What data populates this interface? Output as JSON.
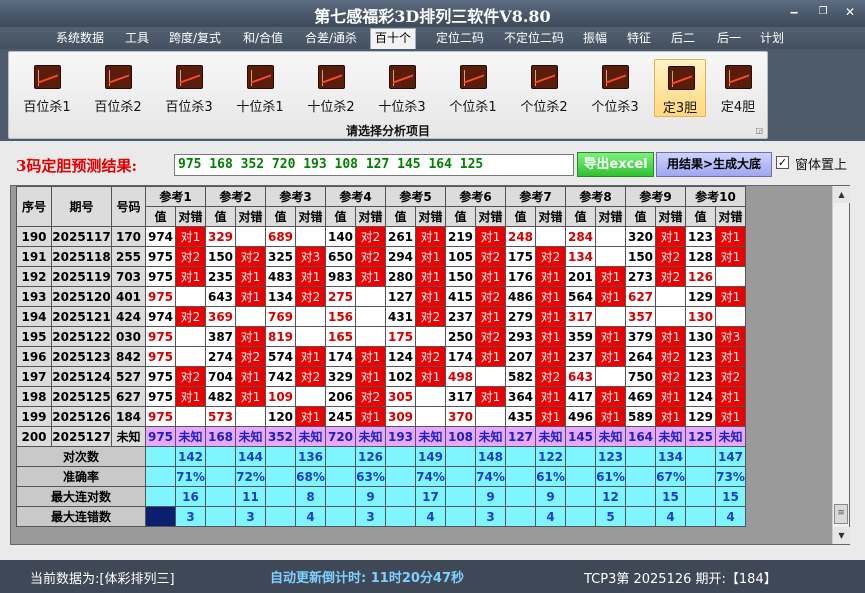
{
  "window": {
    "title": "第七感福彩3D排列三软件V8.80"
  },
  "menu": [
    "系统数据",
    "工具",
    "跨度/复式",
    "和/合值",
    "合差/通杀",
    "百十个",
    "定位二码",
    "不定位二码",
    "振幅",
    "特征",
    "后二",
    "后一",
    "计划"
  ],
  "active_menu": "百十个",
  "ribbon": {
    "buttons": [
      "百位杀1",
      "百位杀2",
      "百位杀3",
      "十位杀1",
      "十位杀2",
      "十位杀3",
      "个位杀1",
      "个位杀2",
      "个位杀3",
      "定3胆",
      "定4胆"
    ],
    "active": "定3胆",
    "group_title": "请选择分析项目"
  },
  "result": {
    "label": "3码定胆预测结果:",
    "value": "975 168 352 720 193 108 127 145 164 125",
    "export_button": "导出excel",
    "generate_button": "用结果>生成大底",
    "topmost_label": "窗体置上",
    "topmost_checked": "✓"
  },
  "grid": {
    "headers": {
      "seq": "序号",
      "period": "期号",
      "code": "号码",
      "val": "值",
      "cmp": "对错"
    },
    "refs": [
      "参考1",
      "参考2",
      "参考3",
      "参考4",
      "参考5",
      "参考6",
      "参考7",
      "参考8",
      "参考9",
      "参考10"
    ],
    "rows": [
      {
        "seq": "190",
        "period": "2025117",
        "code": "170",
        "cells": [
          [
            "974",
            "对1"
          ],
          [
            "329",
            ""
          ],
          [
            "689",
            ""
          ],
          [
            "140",
            "对2"
          ],
          [
            "261",
            "对1"
          ],
          [
            "219",
            "对1"
          ],
          [
            "248",
            ""
          ],
          [
            "284",
            ""
          ],
          [
            "320",
            "对1"
          ],
          [
            "123",
            "对1"
          ]
        ]
      },
      {
        "seq": "191",
        "period": "2025118",
        "code": "255",
        "cells": [
          [
            "975",
            "对2"
          ],
          [
            "150",
            "对2"
          ],
          [
            "325",
            "对3"
          ],
          [
            "650",
            "对2"
          ],
          [
            "294",
            "对1"
          ],
          [
            "105",
            "对2"
          ],
          [
            "175",
            "对2"
          ],
          [
            "134",
            ""
          ],
          [
            "150",
            "对2"
          ],
          [
            "128",
            "对1"
          ]
        ]
      },
      {
        "seq": "192",
        "period": "2025119",
        "code": "703",
        "cells": [
          [
            "975",
            "对1"
          ],
          [
            "235",
            "对1"
          ],
          [
            "483",
            "对1"
          ],
          [
            "983",
            "对1"
          ],
          [
            "280",
            "对1"
          ],
          [
            "150",
            "对1"
          ],
          [
            "176",
            "对1"
          ],
          [
            "201",
            "对1"
          ],
          [
            "273",
            "对2"
          ],
          [
            "126",
            ""
          ]
        ]
      },
      {
        "seq": "193",
        "period": "2025120",
        "code": "401",
        "cells": [
          [
            "975",
            ""
          ],
          [
            "643",
            "对1"
          ],
          [
            "134",
            "对2"
          ],
          [
            "275",
            ""
          ],
          [
            "127",
            "对1"
          ],
          [
            "415",
            "对2"
          ],
          [
            "486",
            "对1"
          ],
          [
            "564",
            "对1"
          ],
          [
            "627",
            ""
          ],
          [
            "129",
            "对1"
          ]
        ]
      },
      {
        "seq": "194",
        "period": "2025121",
        "code": "424",
        "cells": [
          [
            "974",
            "对2"
          ],
          [
            "369",
            ""
          ],
          [
            "769",
            ""
          ],
          [
            "156",
            ""
          ],
          [
            "431",
            "对2"
          ],
          [
            "237",
            "对1"
          ],
          [
            "279",
            "对1"
          ],
          [
            "317",
            ""
          ],
          [
            "357",
            ""
          ],
          [
            "130",
            ""
          ]
        ]
      },
      {
        "seq": "195",
        "period": "2025122",
        "code": "030",
        "cells": [
          [
            "975",
            ""
          ],
          [
            "387",
            "对1"
          ],
          [
            "819",
            ""
          ],
          [
            "165",
            ""
          ],
          [
            "175",
            ""
          ],
          [
            "250",
            "对2"
          ],
          [
            "293",
            "对1"
          ],
          [
            "359",
            "对1"
          ],
          [
            "379",
            "对1"
          ],
          [
            "130",
            "对3"
          ]
        ]
      },
      {
        "seq": "196",
        "period": "2025123",
        "code": "842",
        "cells": [
          [
            "975",
            ""
          ],
          [
            "274",
            "对2"
          ],
          [
            "574",
            "对1"
          ],
          [
            "174",
            "对1"
          ],
          [
            "124",
            "对2"
          ],
          [
            "174",
            "对1"
          ],
          [
            "207",
            "对1"
          ],
          [
            "237",
            "对1"
          ],
          [
            "264",
            "对2"
          ],
          [
            "123",
            "对1"
          ]
        ]
      },
      {
        "seq": "197",
        "period": "2025124",
        "code": "527",
        "cells": [
          [
            "975",
            "对2"
          ],
          [
            "704",
            "对1"
          ],
          [
            "742",
            "对2"
          ],
          [
            "329",
            "对1"
          ],
          [
            "102",
            "对1"
          ],
          [
            "498",
            ""
          ],
          [
            "582",
            "对2"
          ],
          [
            "643",
            ""
          ],
          [
            "750",
            "对2"
          ],
          [
            "123",
            "对2"
          ]
        ]
      },
      {
        "seq": "198",
        "period": "2025125",
        "code": "627",
        "cells": [
          [
            "975",
            "对1"
          ],
          [
            "482",
            "对1"
          ],
          [
            "109",
            ""
          ],
          [
            "206",
            "对2"
          ],
          [
            "305",
            ""
          ],
          [
            "317",
            "对1"
          ],
          [
            "364",
            "对1"
          ],
          [
            "417",
            "对1"
          ],
          [
            "469",
            "对1"
          ],
          [
            "124",
            "对1"
          ]
        ]
      },
      {
        "seq": "199",
        "period": "2025126",
        "code": "184",
        "cells": [
          [
            "975",
            ""
          ],
          [
            "573",
            ""
          ],
          [
            "120",
            "对1"
          ],
          [
            "245",
            "对1"
          ],
          [
            "309",
            ""
          ],
          [
            "370",
            ""
          ],
          [
            "435",
            "对1"
          ],
          [
            "496",
            "对1"
          ],
          [
            "589",
            "对1"
          ],
          [
            "129",
            "对1"
          ]
        ]
      },
      {
        "seq": "200",
        "period": "2025127",
        "code": "未知",
        "cells": [
          [
            "975",
            "未知"
          ],
          [
            "168",
            "未知"
          ],
          [
            "352",
            "未知"
          ],
          [
            "720",
            "未知"
          ],
          [
            "193",
            "未知"
          ],
          [
            "108",
            "未知"
          ],
          [
            "127",
            "未知"
          ],
          [
            "145",
            "未知"
          ],
          [
            "164",
            "未知"
          ],
          [
            "125",
            "未知"
          ]
        ]
      }
    ],
    "stats": [
      {
        "label": "对次数",
        "values": [
          "142",
          "144",
          "136",
          "126",
          "149",
          "148",
          "122",
          "123",
          "134",
          "147"
        ]
      },
      {
        "label": "准确率",
        "values": [
          "71%",
          "72%",
          "68%",
          "63%",
          "74%",
          "74%",
          "61%",
          "61%",
          "67%",
          "73%"
        ]
      },
      {
        "label": "最大连对数",
        "values": [
          "16",
          "11",
          "8",
          "9",
          "17",
          "9",
          "9",
          "12",
          "15",
          "15"
        ]
      },
      {
        "label": "最大连错数",
        "values": [
          "3",
          "3",
          "4",
          "3",
          "4",
          "3",
          "4",
          "5",
          "4",
          "4"
        ]
      }
    ]
  },
  "status": {
    "data_source": "当前数据为:[体彩排列三]",
    "countdown": "自动更新倒计时: 11时20分47秒",
    "issue": "TCP3第 2025126 期开:【184】"
  },
  "scroll": {
    "up": "▲",
    "down": "▼",
    "thumb": "≡"
  },
  "colors": {
    "titlebar": "#4b596c",
    "hit": "#ee0000",
    "pending": "#e8a8ff",
    "stats": "#7ff6ff",
    "result_label": "#e00000"
  }
}
